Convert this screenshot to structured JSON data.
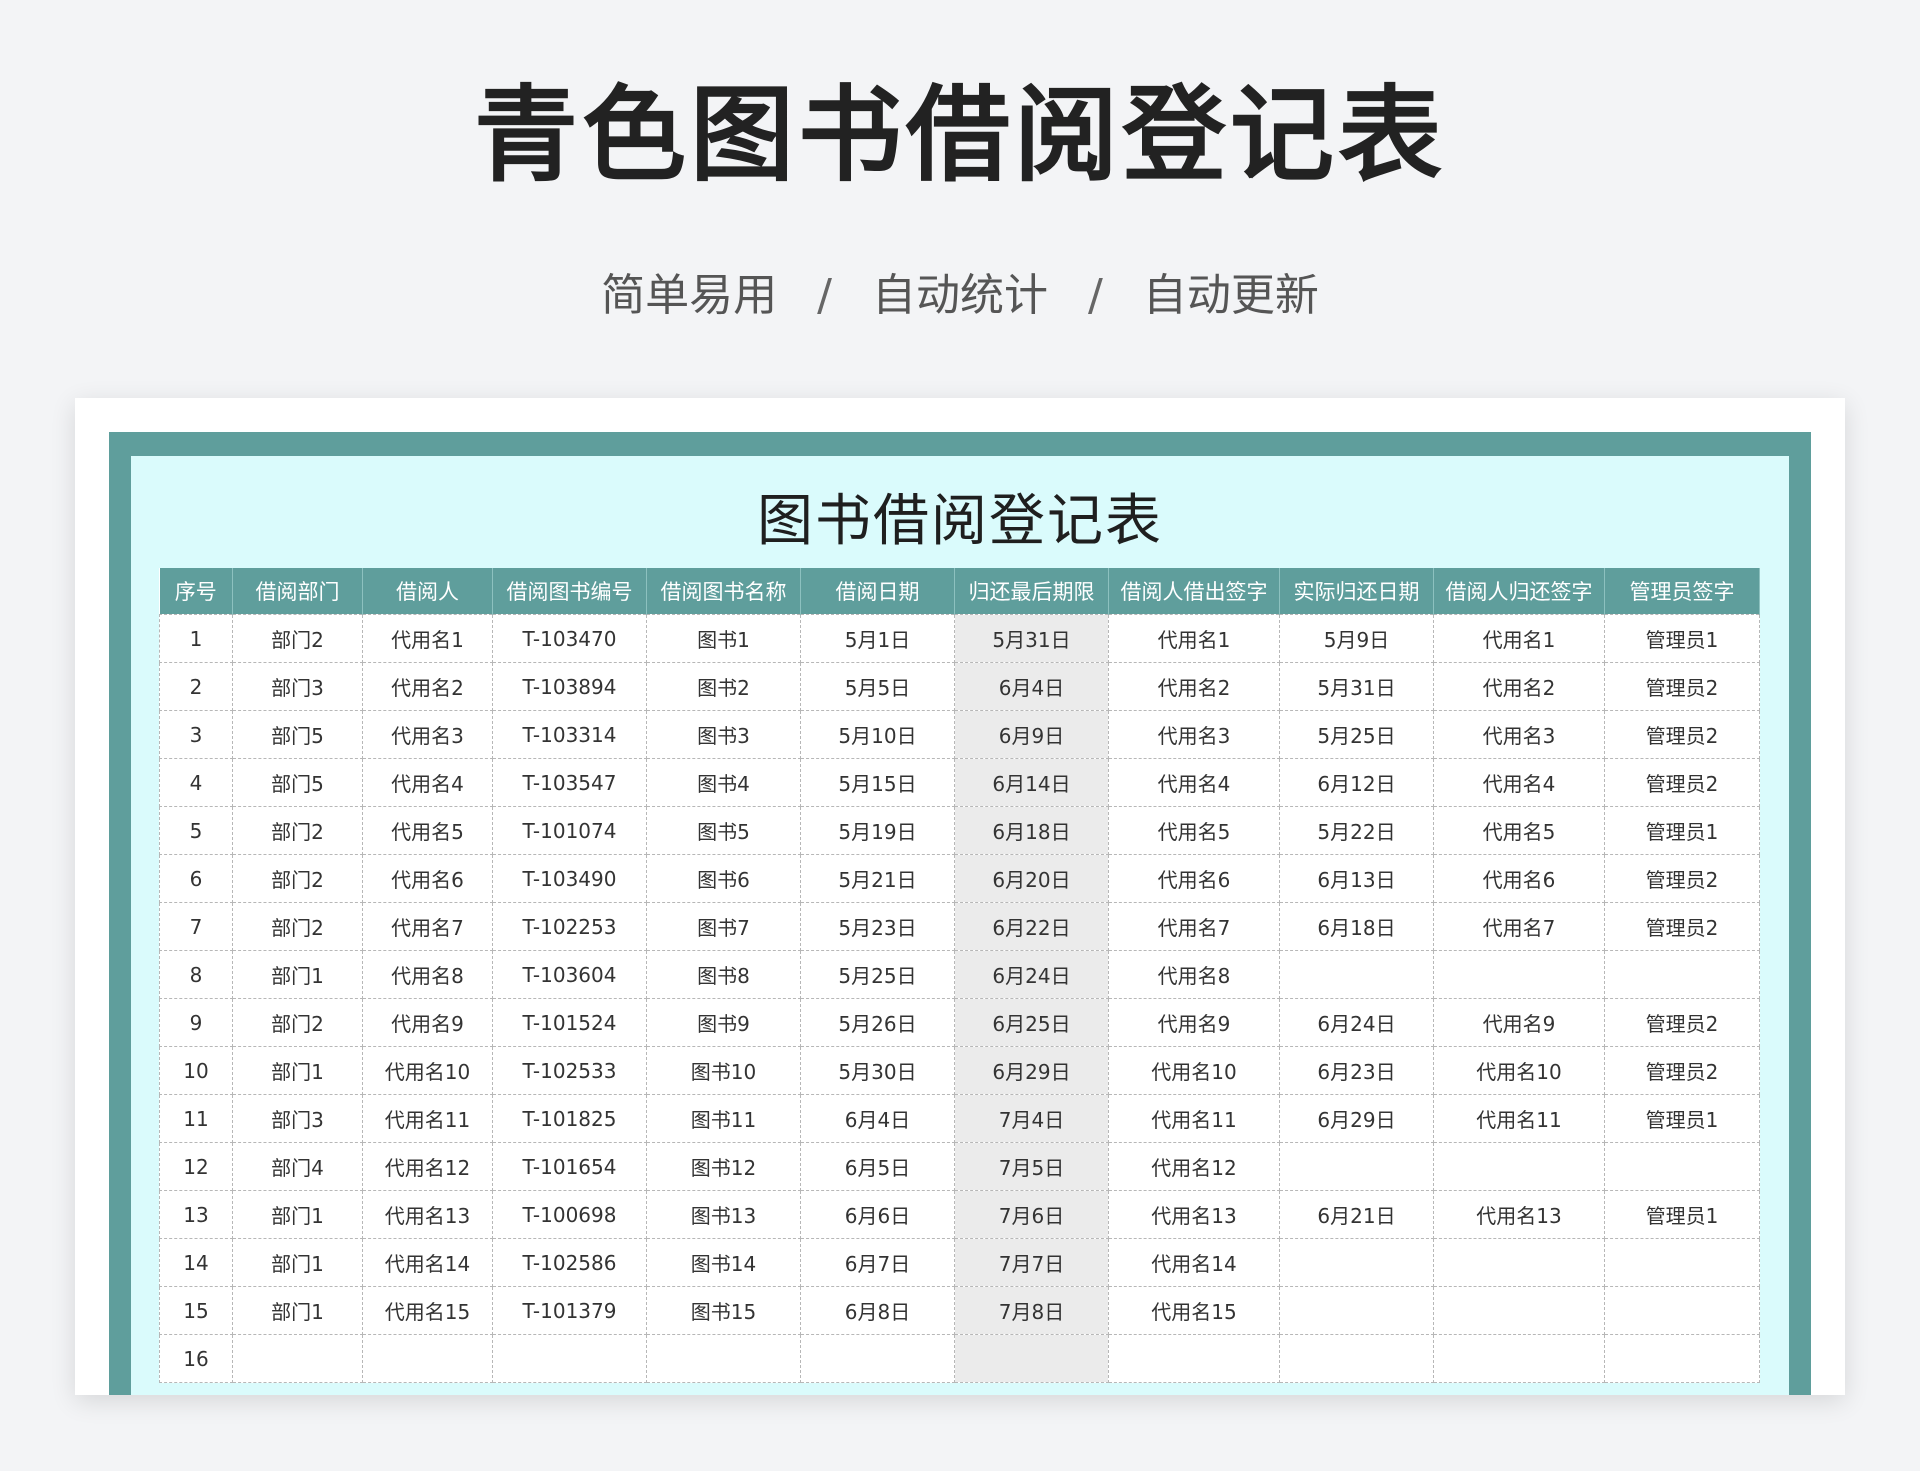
{
  "header": {
    "title": "青色图书借阅登记表",
    "features": [
      "简单易用",
      "自动统计",
      "自动更新"
    ],
    "separator": "/"
  },
  "sheet": {
    "title": "图书借阅登记表",
    "columns": [
      "序号",
      "借阅部门",
      "借阅人",
      "借阅图书编号",
      "借阅图书名称",
      "借阅日期",
      "归还最后期限",
      "借阅人借出签字",
      "实际归还日期",
      "借阅人归还签字",
      "管理员签字"
    ],
    "rows": [
      [
        "1",
        "部门2",
        "代用名1",
        "T-103470",
        "图书1",
        "5月1日",
        "5月31日",
        "代用名1",
        "5月9日",
        "代用名1",
        "管理员1"
      ],
      [
        "2",
        "部门3",
        "代用名2",
        "T-103894",
        "图书2",
        "5月5日",
        "6月4日",
        "代用名2",
        "5月31日",
        "代用名2",
        "管理员2"
      ],
      [
        "3",
        "部门5",
        "代用名3",
        "T-103314",
        "图书3",
        "5月10日",
        "6月9日",
        "代用名3",
        "5月25日",
        "代用名3",
        "管理员2"
      ],
      [
        "4",
        "部门5",
        "代用名4",
        "T-103547",
        "图书4",
        "5月15日",
        "6月14日",
        "代用名4",
        "6月12日",
        "代用名4",
        "管理员2"
      ],
      [
        "5",
        "部门2",
        "代用名5",
        "T-101074",
        "图书5",
        "5月19日",
        "6月18日",
        "代用名5",
        "5月22日",
        "代用名5",
        "管理员1"
      ],
      [
        "6",
        "部门2",
        "代用名6",
        "T-103490",
        "图书6",
        "5月21日",
        "6月20日",
        "代用名6",
        "6月13日",
        "代用名6",
        "管理员2"
      ],
      [
        "7",
        "部门2",
        "代用名7",
        "T-102253",
        "图书7",
        "5月23日",
        "6月22日",
        "代用名7",
        "6月18日",
        "代用名7",
        "管理员2"
      ],
      [
        "8",
        "部门1",
        "代用名8",
        "T-103604",
        "图书8",
        "5月25日",
        "6月24日",
        "代用名8",
        "",
        "",
        ""
      ],
      [
        "9",
        "部门2",
        "代用名9",
        "T-101524",
        "图书9",
        "5月26日",
        "6月25日",
        "代用名9",
        "6月24日",
        "代用名9",
        "管理员2"
      ],
      [
        "10",
        "部门1",
        "代用名10",
        "T-102533",
        "图书10",
        "5月30日",
        "6月29日",
        "代用名10",
        "6月23日",
        "代用名10",
        "管理员2"
      ],
      [
        "11",
        "部门3",
        "代用名11",
        "T-101825",
        "图书11",
        "6月4日",
        "7月4日",
        "代用名11",
        "6月29日",
        "代用名11",
        "管理员1"
      ],
      [
        "12",
        "部门4",
        "代用名12",
        "T-101654",
        "图书12",
        "6月5日",
        "7月5日",
        "代用名12",
        "",
        "",
        ""
      ],
      [
        "13",
        "部门1",
        "代用名13",
        "T-100698",
        "图书13",
        "6月6日",
        "7月6日",
        "代用名13",
        "6月21日",
        "代用名13",
        "管理员1"
      ],
      [
        "14",
        "部门1",
        "代用名14",
        "T-102586",
        "图书14",
        "6月7日",
        "7月7日",
        "代用名14",
        "",
        "",
        ""
      ],
      [
        "15",
        "部门1",
        "代用名15",
        "T-101379",
        "图书15",
        "6月8日",
        "7月8日",
        "代用名15",
        "",
        "",
        ""
      ],
      [
        "16",
        "",
        "",
        "",
        "",
        "",
        "",
        "",
        "",
        "",
        ""
      ]
    ]
  },
  "colors": {
    "frame": "#5f9e9c",
    "header_bg": "#5f9e9c",
    "inner_bg": "#dafbfc",
    "deadline_column_bg": "#ebebeb"
  }
}
